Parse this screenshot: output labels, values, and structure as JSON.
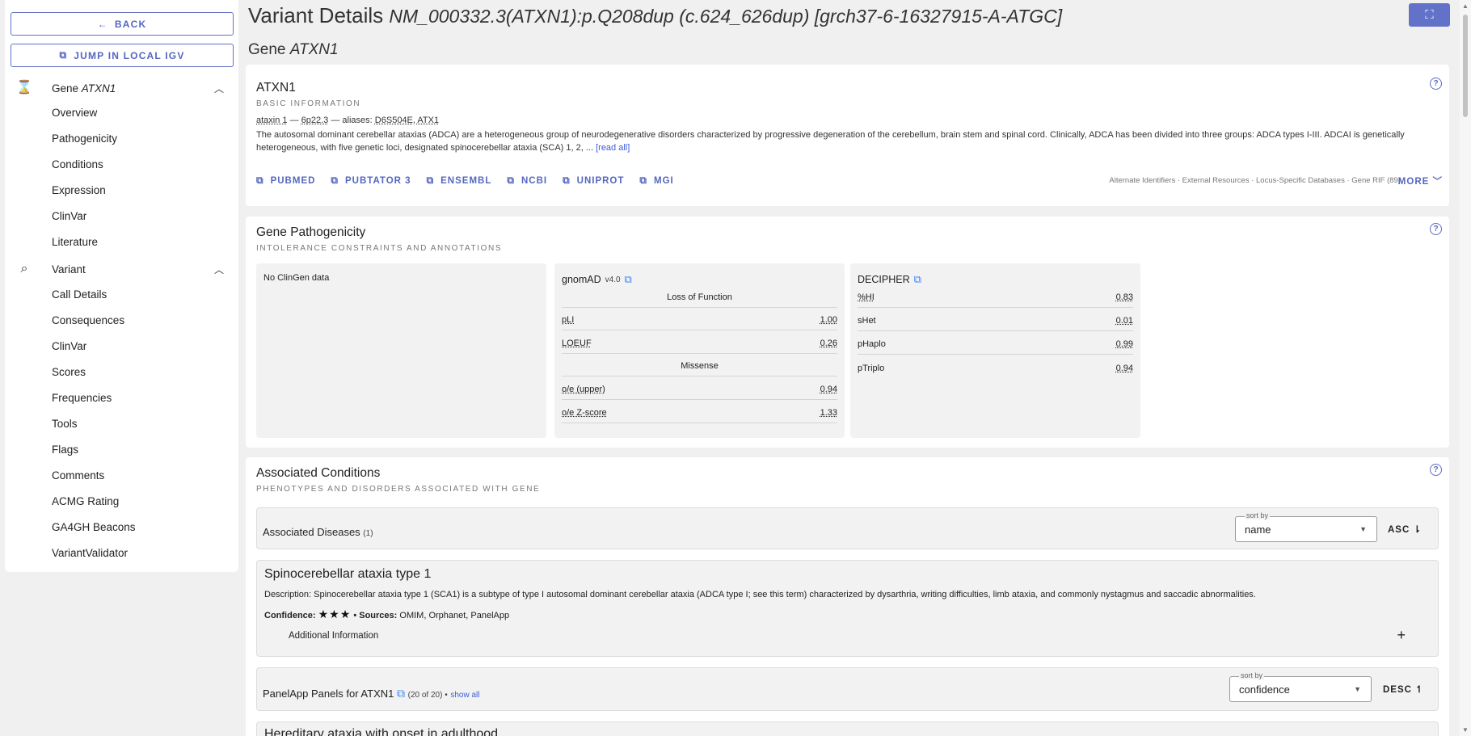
{
  "sidebar": {
    "back_label": "BACK",
    "igv_label": "JUMP IN LOCAL IGV",
    "gene_group": {
      "prefix": "Gene",
      "gene": "ATXN1"
    },
    "gene_items": [
      "Overview",
      "Pathogenicity",
      "Conditions",
      "Expression",
      "ClinVar",
      "Literature"
    ],
    "variant_group": {
      "label": "Variant"
    },
    "variant_items": [
      "Call Details",
      "Consequences",
      "ClinVar",
      "Scores",
      "Frequencies",
      "Tools",
      "Flags",
      "Comments",
      "ACMG Rating",
      "GA4GH Beacons",
      "VariantValidator"
    ]
  },
  "header": {
    "title": "Variant Details",
    "variant": "NM_000332.3(ATXN1):p.Q208dup (c.624_626dup) [grch37-6-16327915-A-ATGC]",
    "gene_prefix": "Gene",
    "gene": "ATXN1"
  },
  "gene_card": {
    "title": "ATXN1",
    "subtitle": "BASIC INFORMATION",
    "name": "ataxin 1",
    "sep1": "—",
    "locus": "6p22.3",
    "sep2": "— aliases:",
    "aliases": "D6S504E, ATX1",
    "description": "The autosomal dominant cerebellar ataxias (ADCA) are a heterogeneous group of neurodegenerative disorders characterized by progressive degeneration of the cerebellum, brain stem and spinal cord. Clinically, ADCA has been divided into three groups: ADCA types I-III. ADCAI is genetically heterogeneous, with five genetic loci, designated spinocerebellar ataxia (SCA) 1, 2, ...",
    "read_all": "[read all]",
    "links": [
      "PUBMED",
      "PUBTATOR 3",
      "ENSEMBL",
      "NCBI",
      "UNIPROT",
      "MGI"
    ],
    "right_links": "Alternate Identifiers · External Resources · Locus-Specific Databases · Gene RIF (89)",
    "more_label": "MORE"
  },
  "pathogenicity": {
    "title": "Gene Pathogenicity",
    "subtitle": "INTOLERANCE CONSTRAINTS AND ANNOTATIONS",
    "clingen": "No ClinGen data",
    "gnomad": {
      "title": "gnomAD",
      "version": "v4.0",
      "lof_header": "Loss of Function",
      "pli_label": "pLI",
      "pli": "1.00",
      "loeuf_label": "LOEUF",
      "loeuf": "0.26",
      "mis_header": "Missense",
      "oe_label": "o/e (upper)",
      "oe": "0.94",
      "z_label": "o/e Z-score",
      "z": "1.33"
    },
    "decipher": {
      "title": "DECIPHER",
      "hi_label": "%HI",
      "hi": "0.83",
      "shet_label": "sHet",
      "shet": "0.01",
      "phaplo_label": "pHaplo",
      "phaplo": "0.99",
      "ptriplo_label": "pTriplo",
      "ptriplo": "0.94"
    }
  },
  "conditions": {
    "title": "Associated Conditions",
    "subtitle": "PHENOTYPES AND DISORDERS ASSOCIATED WITH GENE",
    "diseases_label": "Associated Diseases",
    "diseases_count": "(1)",
    "sort_label": "sort by",
    "sort_value": "name",
    "order_label": "ASC",
    "disease": {
      "title": "Spinocerebellar ataxia type 1",
      "description": "Description: Spinocerebellar ataxia type 1 (SCA1) is a subtype of type I autosomal dominant cerebellar ataxia (ADCA type I; see this term) characterized by dysarthria, writing difficulties, limb ataxia, and commonly nystagmus and saccadic abnormalities.",
      "confidence_label": "Confidence:",
      "stars": "★★★",
      "sources_label": "• Sources:",
      "sources": "OMIM, Orphanet, PanelApp",
      "additional": "Additional Information"
    },
    "panelapp_label": "PanelApp Panels for ATXN1",
    "panelapp_count": "(20 of 20) •",
    "show_all": "show all",
    "panel_sort_label": "sort by",
    "panel_sort_value": "confidence",
    "panel_order_label": "DESC",
    "next_item": "Hereditary ataxia with onset in adulthood"
  }
}
